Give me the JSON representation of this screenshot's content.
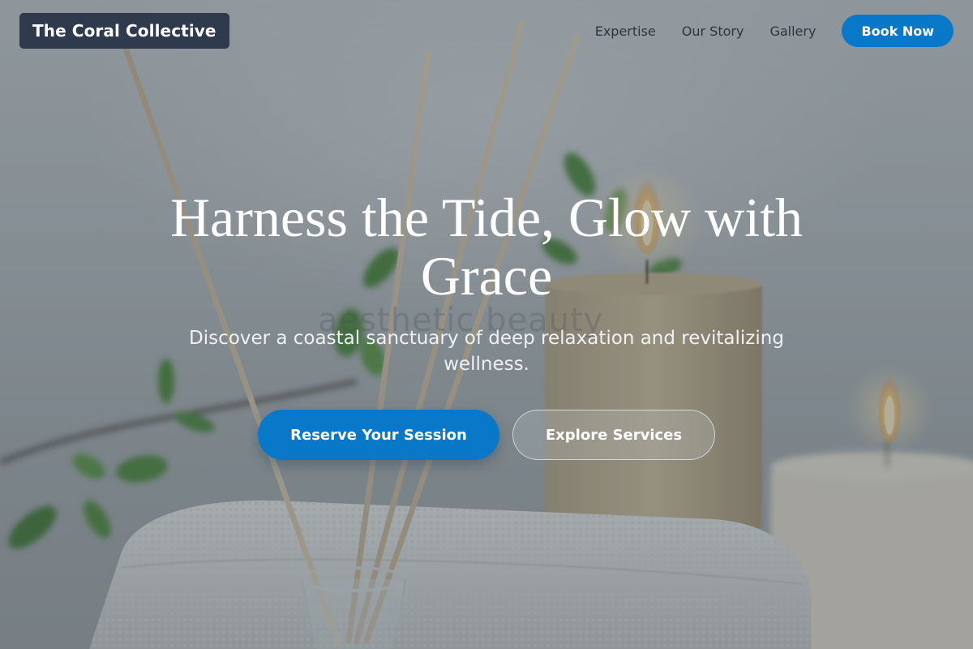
{
  "header": {
    "brand": "The Coral Collective",
    "nav": [
      {
        "label": "Expertise"
      },
      {
        "label": "Our Story"
      },
      {
        "label": "Gallery"
      }
    ],
    "book_label": "Book Now"
  },
  "hero": {
    "title": "Harness the Tide, Glow with Grace",
    "subtitle": "Discover a coastal sanctuary of deep relaxation and revitalizing wellness.",
    "watermark": "aesthetic beauty",
    "primary_cta": "Reserve Your Session",
    "secondary_cta": "Explore Services"
  },
  "colors": {
    "accent": "#0a78c9",
    "brand_bg": "#2f3b4c",
    "nav_text": "#2c3640"
  },
  "background": {
    "image_subject": "spa scene with reed diffuser, candles, folded white towel and green leaves",
    "icons": [
      "reed-diffuser-icon",
      "candle-icon",
      "towel-icon",
      "leaf-icon"
    ]
  }
}
